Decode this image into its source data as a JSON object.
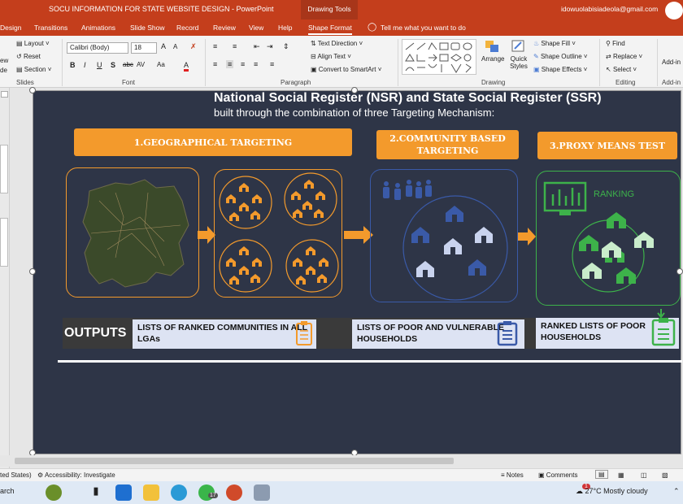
{
  "titlebar": {
    "document_title": "SOCU INFORMATION FOR STATE WEBSITE DESIGN  -  PowerPoint",
    "context_tab": "Drawing Tools",
    "user_email": "idowuolabisiadeola@gmail.com"
  },
  "tabs": [
    "Design",
    "Transitions",
    "Animations",
    "Slide Show",
    "Record",
    "Review",
    "View",
    "Help",
    "Shape Format"
  ],
  "active_tab": "Shape Format",
  "tell_me": "Tell me what you want to do",
  "ribbon": {
    "slides": {
      "layout": "Layout",
      "reset": "Reset",
      "section": "Section",
      "new_partial": "ew",
      "de_partial": "de",
      "label": "Slides"
    },
    "font": {
      "name": "Calibri (Body)",
      "size": "18",
      "bold": "B",
      "italic": "I",
      "underline": "U",
      "shadow": "S",
      "strike": "abc",
      "spacing": "AV",
      "case": "Aa",
      "color": "A",
      "grow": "A",
      "shrink": "A",
      "label": "Font"
    },
    "paragraph": {
      "text_direction": "Text Direction",
      "align_text": "Align Text",
      "smartart": "Convert to SmartArt",
      "label": "Paragraph"
    },
    "drawing": {
      "arrange": "Arrange",
      "quick_styles_1": "Quick",
      "quick_styles_2": "Styles",
      "shape_fill": "Shape Fill",
      "shape_outline": "Shape Outline",
      "shape_effects": "Shape Effects",
      "label": "Drawing"
    },
    "editing": {
      "find": "Find",
      "replace": "Replace",
      "select": "Select",
      "label": "Editing"
    },
    "addins": {
      "label1": "Add-in",
      "label2": "Add-in"
    }
  },
  "slide": {
    "title": "National Social Register (NSR) and State Social Register (SSR)",
    "subtitle": "built through the combination of three Targeting Mechanism:",
    "step1": "1.GEOGRAPHICAL TARGETING",
    "step2": "2.COMMUNITY BASED TARGETING",
    "step3": "3.PROXY MEANS TEST",
    "ranking": "RANKING",
    "outputs": "OUTPUTS",
    "out1": "LISTS OF RANKED COMMUNITIES IN ALL LGAs",
    "out2": "LISTS OF POOR AND VULNERABLE HOUSEHOLDS",
    "out3": "RANKED LISTS OF POOR HOUSEHOLDS",
    "colors": {
      "orange": "#f39a2c",
      "blue": "#3a5aa8",
      "green": "#3db24a",
      "bg": "#2e3547"
    }
  },
  "statusbar": {
    "states": "ted States)",
    "accessibility": "Accessibility: Investigate",
    "notes": "Notes",
    "comments": "Comments"
  },
  "taskbar": {
    "search": "arch",
    "whatsapp_badge": "17",
    "weather": "27°C  Mostly cloudy",
    "weather_badge": "1"
  }
}
